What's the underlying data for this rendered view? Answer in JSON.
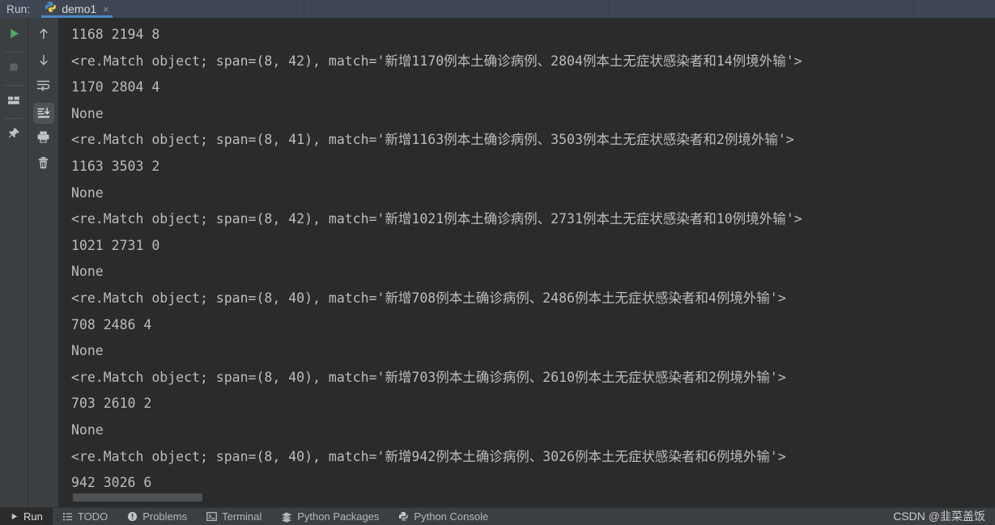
{
  "window": {
    "run_label": "Run:",
    "tab": {
      "title": "demo1",
      "icon": "python-icon",
      "close": "×"
    }
  },
  "colors": {
    "topbar_bg": "#3e4654",
    "panel_bg": "#3c3f41",
    "console_bg": "#2b2b2b",
    "console_text": "#bcbcbc",
    "tab_underline": "#4a88c7",
    "run_green": "#59a869",
    "highlight_bg": "#4e5254"
  },
  "left_toolbar": {
    "items": [
      {
        "name": "run-button",
        "icon": "play-icon",
        "title": "Rerun"
      },
      {
        "name": "stop-button",
        "icon": "stop-square-icon",
        "title": "Stop"
      },
      {
        "name": "layout-button",
        "icon": "layout-icon",
        "title": "Layout"
      },
      {
        "name": "pin-button",
        "icon": "pin-icon",
        "title": "Pin Tab"
      }
    ]
  },
  "console_toolbar": {
    "items": [
      {
        "name": "up-button",
        "icon": "arrow-up-icon",
        "title": "Up the stack trace",
        "active": false
      },
      {
        "name": "down-button",
        "icon": "arrow-down-icon",
        "title": "Down the stack trace",
        "active": false
      },
      {
        "name": "soft-wrap-button",
        "icon": "soft-wrap-icon",
        "title": "Soft-Wrap",
        "active": false
      },
      {
        "name": "scroll-to-end-button",
        "icon": "scroll-to-end-icon",
        "title": "Scroll to End",
        "active": true
      },
      {
        "name": "print-button",
        "icon": "printer-icon",
        "title": "Print",
        "active": false
      },
      {
        "name": "clear-button",
        "icon": "trash-icon",
        "title": "Clear All",
        "active": false
      }
    ]
  },
  "console": {
    "lines": [
      "1168 2194 8",
      "<re.Match object; span=(8, 42), match='新增1170例本土确诊病例、2804例本土无症状感染者和14例境外输'>",
      "1170 2804 4",
      "None",
      "<re.Match object; span=(8, 41), match='新增1163例本土确诊病例、3503例本土无症状感染者和2例境外输'>",
      "1163 3503 2",
      "None",
      "<re.Match object; span=(8, 42), match='新增1021例本土确诊病例、2731例本土无症状感染者和10例境外输'>",
      "1021 2731 0",
      "None",
      "<re.Match object; span=(8, 40), match='新增708例本土确诊病例、2486例本土无症状感染者和4例境外输'>",
      "708 2486 4",
      "None",
      "<re.Match object; span=(8, 40), match='新增703例本土确诊病例、2610例本土无症状感染者和2例境外输'>",
      "703 2610 2",
      "None",
      "<re.Match object; span=(8, 40), match='新增942例本土确诊病例、3026例本土无症状感染者和6例境外输'>",
      "942 3026 6"
    ]
  },
  "statusbar": {
    "items": [
      {
        "label": "Run",
        "icon": "play-small-icon",
        "active": true
      },
      {
        "label": "TODO",
        "icon": "todo-list-icon",
        "active": false
      },
      {
        "label": "Problems",
        "icon": "warning-circle-icon",
        "active": false
      },
      {
        "label": "Terminal",
        "icon": "terminal-icon",
        "active": false
      },
      {
        "label": "Python Packages",
        "icon": "packages-icon",
        "active": false
      },
      {
        "label": "Python Console",
        "icon": "python-small-icon",
        "active": false
      }
    ]
  },
  "watermark": {
    "text": "CSDN @韭菜盖饭"
  }
}
